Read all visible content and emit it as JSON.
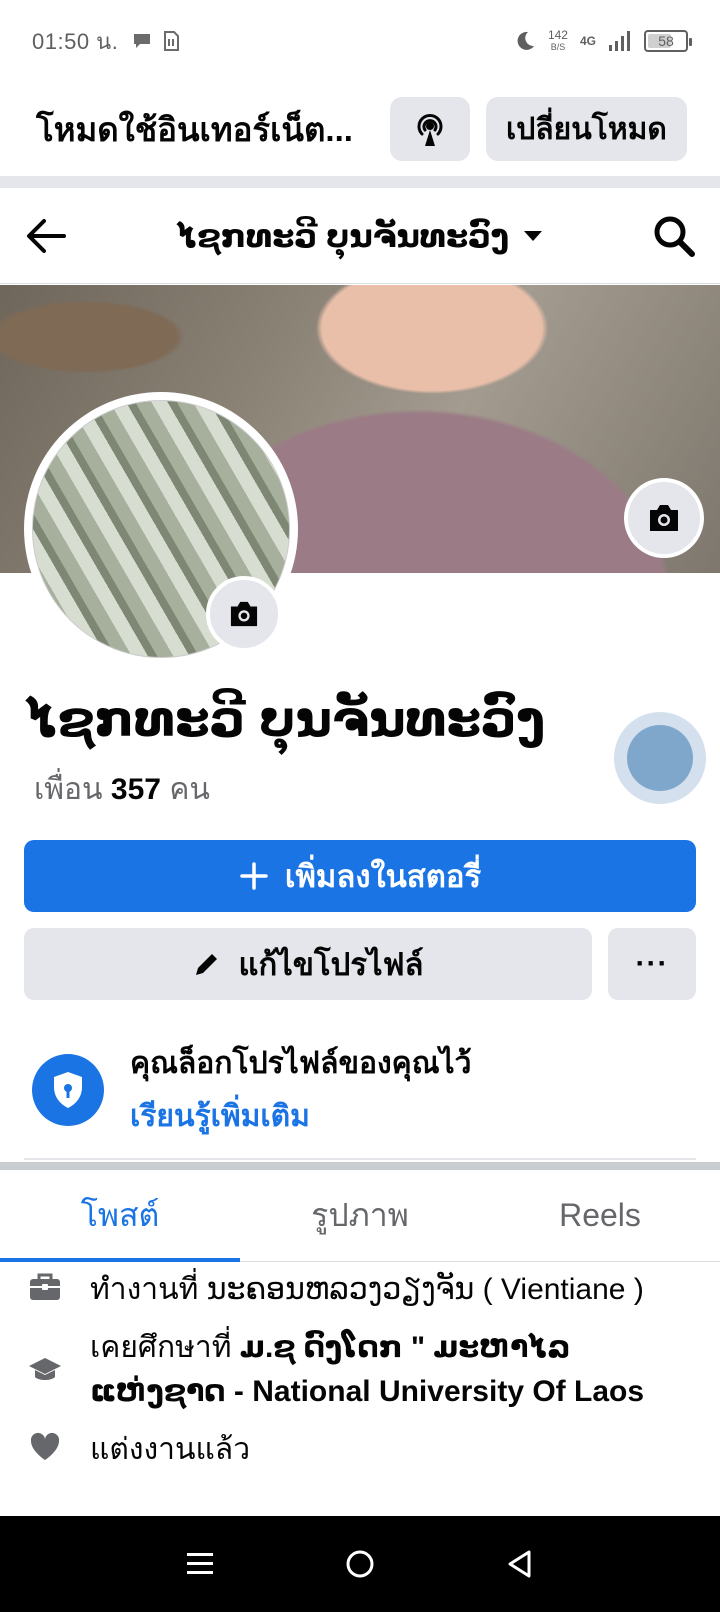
{
  "status_bar": {
    "time": "01:50 น.",
    "speed_value": "142",
    "speed_unit": "B/S",
    "network": "4G",
    "battery": "58",
    "battery_level": 0.58
  },
  "mode_bar": {
    "title": "โหมดใช้อินเทอร์เน็ต...",
    "switch_label": "เปลี่ยนโหมด"
  },
  "nav": {
    "title": "ໄຊກທະວີ ບຸນຈັນທະວົງ"
  },
  "profile": {
    "name": "ໄຊກທະວີ ບຸນຈັນທະວົງ",
    "friends_prefix": "เพื่อน",
    "friends_count": "357",
    "friends_suffix": "คน"
  },
  "actions": {
    "add_story": "เพิ่มลงในสตอรี่",
    "edit_profile": "แก้ไขโปรไฟล์",
    "more": "···"
  },
  "lock": {
    "message": "คุณล็อกโปรไฟล์ของคุณไว้",
    "learn_more": "เรียนรู้เพิ่มเติม"
  },
  "tabs": [
    {
      "label": "โพสต์",
      "active": true
    },
    {
      "label": "รูปภาพ",
      "active": false
    },
    {
      "label": "Reels",
      "active": false
    }
  ],
  "intro": {
    "work": "ทำงานที่ ນະຄອນຫລວງວຽງຈັນ ( Vientiane )",
    "education_prefix": "เคยศึกษาที่",
    "education_school": "ມ.ຊ ດົງໂດກ \" ມະຫາໄລແຫ່ງຊາດ - National University Of Laos",
    "relationship": "แต่งงานแล้ว"
  },
  "colors": {
    "accent": "#1b74e4",
    "button_gray": "#e4e6eb",
    "text": "#050505",
    "muted": "#65676b"
  }
}
